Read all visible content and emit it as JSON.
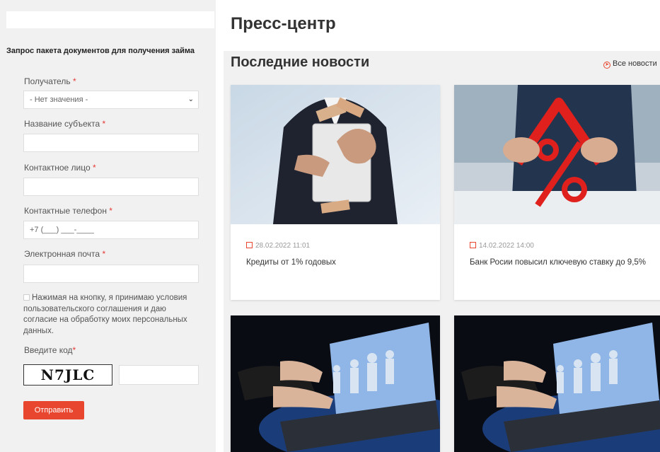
{
  "sidebar": {
    "form_title": "Запрос пакета документов для получения займа",
    "fields": {
      "recipient_label": "Получатель",
      "recipient_value": "- Нет значения -",
      "subject_label": "Название субъекта",
      "contact_person_label": "Контактное лицо",
      "phone_label": "Контактные телефон",
      "phone_placeholder": "+7 (___) ___-____",
      "email_label": "Электронная почта",
      "required_mark": "*"
    },
    "agreement_text": "Нажимая на кнопку, я принимаю условия пользовательского соглашения и даю согласие на обработку моих персональных данных.",
    "captcha_label": "Введите код",
    "captcha_code": "N7JLC",
    "submit_label": "Отправить"
  },
  "main": {
    "page_title": "Пресс-центр",
    "section_title": "Последние новости",
    "all_news_label": "Все новости",
    "news": [
      {
        "date": "28.02.2022 11:01",
        "title": "Кредиты от 1% годовых"
      },
      {
        "date": "14.02.2022 14:00",
        "title": "Банк Росии повысил ключевую ставку до 9,5%"
      }
    ]
  },
  "colors": {
    "accent": "#e8462e",
    "required": "#e53935",
    "sidebar_bg": "#f1f1f1"
  }
}
